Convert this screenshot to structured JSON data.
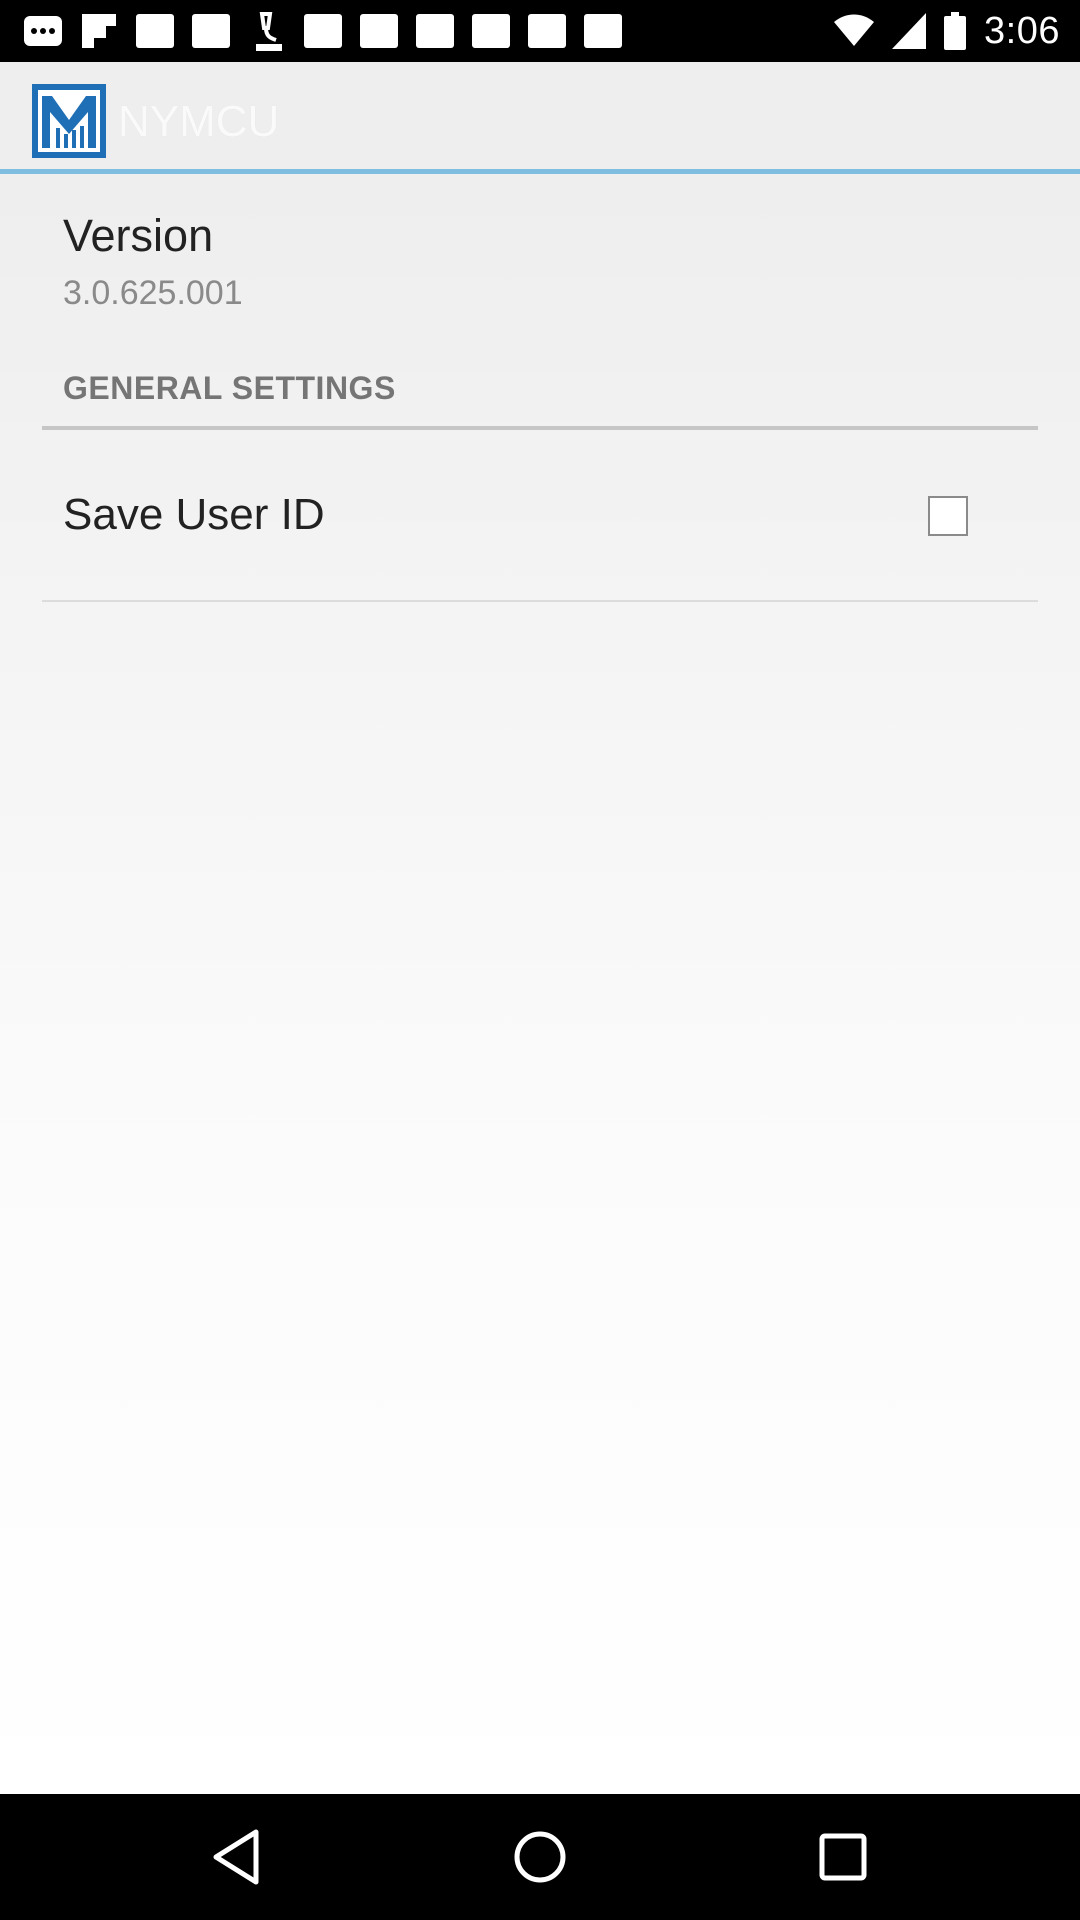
{
  "status_bar": {
    "time": "3:06",
    "left_icons": [
      "more-horiz-icon",
      "flipboard-icon",
      "blank-app-icon",
      "blank-app-icon",
      "microscope-icon",
      "blank-app-icon",
      "blank-app-icon",
      "blank-app-icon",
      "blank-app-icon",
      "blank-app-icon",
      "blank-app-icon"
    ],
    "right_icons": [
      "wifi-icon",
      "signal-icon",
      "battery-icon"
    ]
  },
  "app_bar": {
    "title": "NYMCU",
    "logo_color": "#1f6fb7"
  },
  "settings": {
    "version_title": "Version",
    "version_value": "3.0.625.001",
    "section_header": "GENERAL SETTINGS",
    "save_user_id": {
      "label": "Save User ID",
      "checked": false
    }
  },
  "nav_bar": {
    "buttons": [
      "back-icon",
      "home-icon",
      "recents-icon"
    ]
  }
}
